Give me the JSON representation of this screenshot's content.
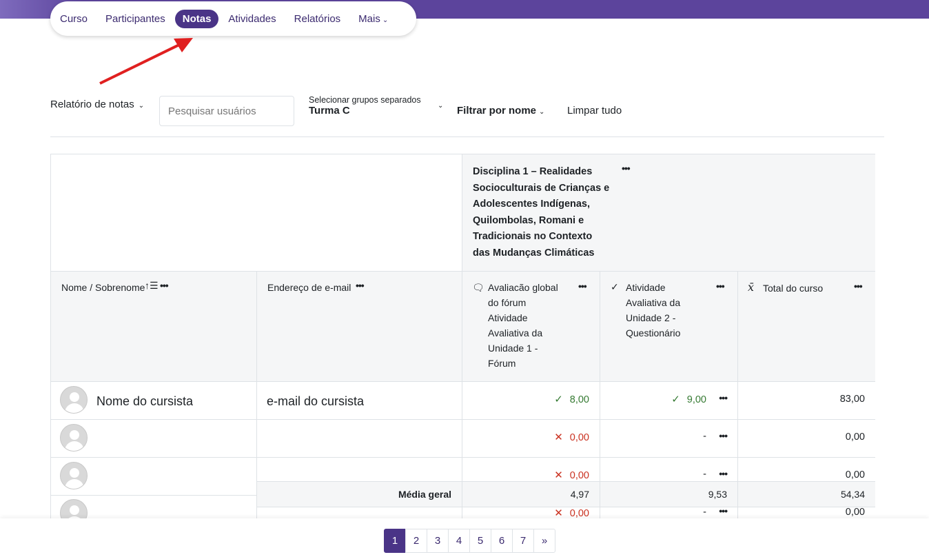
{
  "nav": {
    "items": [
      "Curso",
      "Participantes",
      "Notas",
      "Atividades",
      "Relatórios"
    ],
    "more": "Mais",
    "active": "Notas"
  },
  "toolbar": {
    "report_selector": "Relatório de notas",
    "search_placeholder": "Pesquisar usuários",
    "group_label": "Selecionar grupos separados",
    "group_value": "Turma C",
    "filter_name": "Filtrar por nome",
    "clear_all": "Limpar tudo"
  },
  "table": {
    "category_title": "Disciplina 1 – Realidades Socioculturais de Crianças e Adolescentes Indígenas, Quilombolas, Romani e Tradicionais no Contexto das Mudanças Climáticas",
    "columns": {
      "name": "Nome / Sobrenome",
      "email": "Endereço de e-mail",
      "forum": "Avaliacão global do fórum Atividade Avaliativa da Unidade 1 - Fórum",
      "quiz": "Atividade Avaliativa da Unidade 2 - Questionário",
      "total": "Total do curso"
    },
    "rows": [
      {
        "name": "Nome do cursista",
        "email": "e-mail do cursista",
        "forum": "8,00",
        "forum_status": "ok",
        "quiz": "9,00",
        "quiz_status": "ok",
        "total": "83,00"
      },
      {
        "name": "",
        "email": "",
        "forum": "0,00",
        "forum_status": "bad",
        "quiz": "-",
        "quiz_status": "none",
        "total": "0,00"
      },
      {
        "name": "",
        "email": "",
        "forum": "0,00",
        "forum_status": "bad",
        "quiz": "-",
        "quiz_status": "none",
        "total": "0,00"
      },
      {
        "name": "",
        "email": "",
        "forum": "0,00",
        "forum_status": "bad",
        "quiz": "-",
        "quiz_status": "none",
        "total": "0,00"
      }
    ],
    "average": {
      "label": "Média geral",
      "forum": "4,97",
      "quiz": "9,53",
      "total": "54,34"
    }
  },
  "pagination": {
    "pages": [
      "1",
      "2",
      "3",
      "4",
      "5",
      "6",
      "7"
    ],
    "next": "»",
    "current": "1"
  },
  "colors": {
    "brand": "#4a3487",
    "topbar": "#5c449c",
    "ok": "#357a32",
    "bad": "#ca3120",
    "annotation_arrow": "#e02020"
  }
}
